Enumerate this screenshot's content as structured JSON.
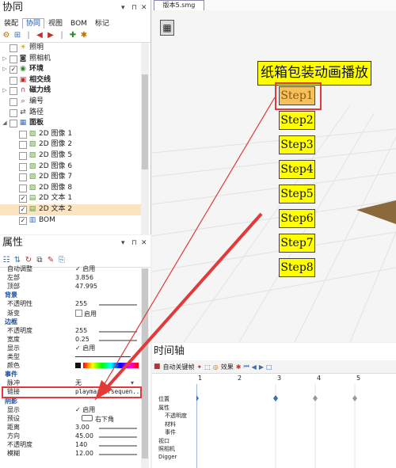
{
  "left_top": {
    "title": "协同",
    "tabs": [
      "装配",
      "协同",
      "视图",
      "BOM",
      "标记"
    ],
    "active_tab": 1,
    "tree": [
      {
        "label": "照明",
        "indent": 1,
        "expand": "",
        "check": "",
        "icon": "light-icon",
        "glyph": "☀",
        "color": "#d4a000"
      },
      {
        "label": "照相机",
        "indent": 1,
        "expand": "▷",
        "check": "",
        "icon": "camera-icon",
        "glyph": "◙",
        "color": "#444"
      },
      {
        "label": "环境",
        "indent": 1,
        "expand": "▷",
        "check": "✓",
        "icon": "environment-icon",
        "glyph": "◉",
        "color": "#2a8a2a",
        "bold": true
      },
      {
        "label": "相交线",
        "indent": 1,
        "expand": "",
        "check": "",
        "icon": "intersect-icon",
        "glyph": "▣",
        "color": "#c03030",
        "bold": true
      },
      {
        "label": "磁力线",
        "indent": 1,
        "expand": "▷",
        "check": "",
        "icon": "magnet-icon",
        "glyph": "∩",
        "color": "#c03030",
        "bold": true
      },
      {
        "label": "编号",
        "indent": 1,
        "expand": "",
        "check": "",
        "icon": "number-icon",
        "glyph": "⌕",
        "color": "#444"
      },
      {
        "label": "路径",
        "indent": 1,
        "expand": "",
        "check": "",
        "icon": "path-icon",
        "glyph": "⇄",
        "color": "#444"
      },
      {
        "label": "面板",
        "indent": 1,
        "expand": "◢",
        "check": "",
        "icon": "panel-icon",
        "glyph": "▦",
        "color": "#3a6fb0",
        "bold": true
      },
      {
        "label": "2D 图像 1",
        "indent": 2,
        "expand": "",
        "check": "",
        "icon": "image-icon",
        "glyph": "▨",
        "color": "#5a9a3a"
      },
      {
        "label": "2D 图像 2",
        "indent": 2,
        "expand": "",
        "check": "",
        "icon": "image-icon",
        "glyph": "▨",
        "color": "#5a9a3a"
      },
      {
        "label": "2D 图像 5",
        "indent": 2,
        "expand": "",
        "check": "",
        "icon": "image-icon",
        "glyph": "▨",
        "color": "#5a9a3a"
      },
      {
        "label": "2D 图像 6",
        "indent": 2,
        "expand": "",
        "check": "",
        "icon": "image-icon",
        "glyph": "▨",
        "color": "#5a9a3a"
      },
      {
        "label": "2D 图像 7",
        "indent": 2,
        "expand": "",
        "check": "",
        "icon": "image-icon",
        "glyph": "▨",
        "color": "#5a9a3a"
      },
      {
        "label": "2D 图像 8",
        "indent": 2,
        "expand": "",
        "check": "",
        "icon": "image-icon",
        "glyph": "▨",
        "color": "#5a9a3a"
      },
      {
        "label": "2D 文本 1",
        "indent": 2,
        "expand": "",
        "check": "✓",
        "icon": "text-icon",
        "glyph": "▤",
        "color": "#5a9a3a"
      },
      {
        "label": "2D 文本 2",
        "indent": 2,
        "expand": "",
        "check": "✓",
        "icon": "text-icon",
        "glyph": "▤",
        "color": "#5a9a3a",
        "selected": true
      },
      {
        "label": "BOM",
        "indent": 2,
        "expand": "",
        "check": "✓",
        "icon": "bom-icon",
        "glyph": "▥",
        "color": "#3a6fb0"
      }
    ]
  },
  "left_bottom": {
    "title": "属性",
    "rows": [
      {
        "key": "自动调整",
        "value": "✓ 启用",
        "kind": "cb",
        "partial": true
      },
      {
        "key": "左部",
        "value": "3.856"
      },
      {
        "key": "顶部",
        "value": "47.995"
      },
      {
        "key": "背景",
        "section": true
      },
      {
        "key": "不透明性",
        "value": "255",
        "slider": true
      },
      {
        "key": "渐变",
        "value": "启用",
        "kind": "cbempty"
      },
      {
        "key": "边框",
        "section": true
      },
      {
        "key": "不透明度",
        "value": "255",
        "slider": true
      },
      {
        "key": "宽度",
        "value": "0.25",
        "slider": true
      },
      {
        "key": "显示",
        "value": "✓ 启用",
        "kind": "cb"
      },
      {
        "key": "类型",
        "value": "",
        "kind": "line"
      },
      {
        "key": "颜色",
        "value": "",
        "kind": "color"
      },
      {
        "key": "事件",
        "section": true
      },
      {
        "key": "脉冲",
        "value": "无",
        "kind": "dd"
      },
      {
        "key": "链接",
        "value": "playmarkersequen...",
        "highlight": true
      },
      {
        "key": "阴影",
        "section": true
      },
      {
        "key": "显示",
        "value": "✓ 启用",
        "kind": "cb"
      },
      {
        "key": "预设",
        "value": "右下角",
        "kind": "preset"
      },
      {
        "key": "距离",
        "value": "3.00",
        "slider": true
      },
      {
        "key": "方向",
        "value": "45.00",
        "slider": true
      },
      {
        "key": "不透明度",
        "value": "140",
        "slider": true
      },
      {
        "key": "模糊",
        "value": "12.00",
        "slider": true
      }
    ]
  },
  "viewport": {
    "doc_tab": "版本5.smg",
    "heading": "纸箱包装动画播放",
    "steps": [
      "Step1",
      "Step2",
      "Step3",
      "Step4",
      "Step5",
      "Step6",
      "Step7",
      "Step8"
    ],
    "highlight_step": 0
  },
  "timeline": {
    "title": "时间轴",
    "auto_key_label": "自动关键帧",
    "effects_label": "效果",
    "ruler": [
      "1",
      "2",
      "3",
      "4",
      "5"
    ],
    "tracks": [
      "位置",
      "属性",
      "不透明度",
      "材料",
      "事件",
      "视口",
      "照相机",
      "Digger"
    ],
    "track_indent": [
      0,
      0,
      1,
      1,
      1,
      0,
      0,
      0
    ]
  }
}
